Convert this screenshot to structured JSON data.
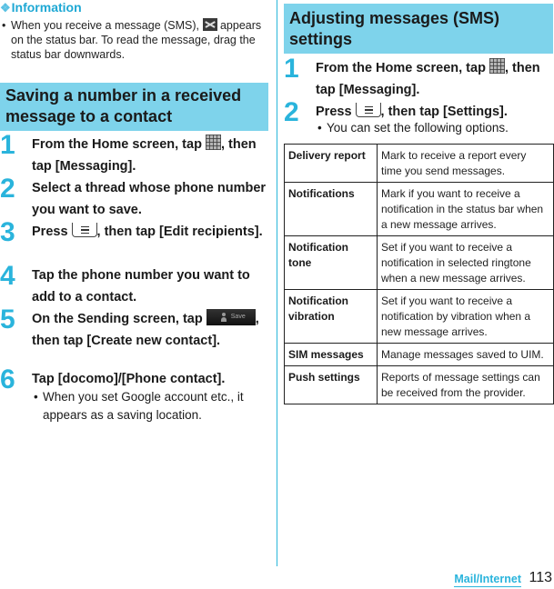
{
  "info": {
    "title": "Information",
    "bullet_before_icon": "When you receive a message (SMS), ",
    "bullet_after_icon": " appears on the status bar. To read the message, drag the status bar downwards.",
    "icon": "sms-envelope-icon"
  },
  "left_section": {
    "heading": "Saving a number in a received message to a contact",
    "steps": [
      {
        "num": "1",
        "pre": "From the Home screen, tap ",
        "icon": "app-grid-icon",
        "post": ", then tap [Messaging]."
      },
      {
        "num": "2",
        "text": "Select a thread whose phone number you want to save."
      },
      {
        "num": "3",
        "pre": "Press ",
        "icon": "menu-key-icon",
        "post": ", then tap [Edit recipients]."
      },
      {
        "num": "4",
        "text": "Tap the phone number you want to add to a contact."
      },
      {
        "num": "5",
        "pre": "On the Sending screen, tap ",
        "icon": "save-contact-button-icon",
        "icon_label": "Save",
        "post": ", then tap [Create new contact]."
      },
      {
        "num": "6",
        "text": "Tap [docomo]/[Phone contact].",
        "note": "When you set Google account etc., it appears as a saving location."
      }
    ]
  },
  "right_section": {
    "heading": "Adjusting messages (SMS) settings",
    "steps": [
      {
        "num": "1",
        "pre": "From the Home screen, tap ",
        "icon": "app-grid-icon",
        "post": ", then tap [Messaging]."
      },
      {
        "num": "2",
        "pre": "Press ",
        "icon": "menu-key-icon",
        "post": ", then tap [Settings].",
        "note": "You can set the following options."
      }
    ],
    "options": [
      {
        "name": "Delivery report",
        "desc": "Mark to receive a report every time you send messages."
      },
      {
        "name": "Notifications",
        "desc": "Mark if you want to receive a notification in the status bar when a new message arrives."
      },
      {
        "name": "Notification tone",
        "desc": "Set if you want to receive a notification in selected ringtone when a new message arrives."
      },
      {
        "name": "Notification vibration",
        "desc": "Set if you want to receive a notification by vibration when a new message arrives."
      },
      {
        "name": "SIM messages",
        "desc": "Manage messages saved to UIM."
      },
      {
        "name": "Push settings",
        "desc": "Reports of message settings can be received from the provider."
      }
    ]
  },
  "footer": {
    "section": "Mail/Internet",
    "page": "113"
  },
  "colors": {
    "accent": "#2ab4dc",
    "heading_bg": "#7ed3eb"
  }
}
